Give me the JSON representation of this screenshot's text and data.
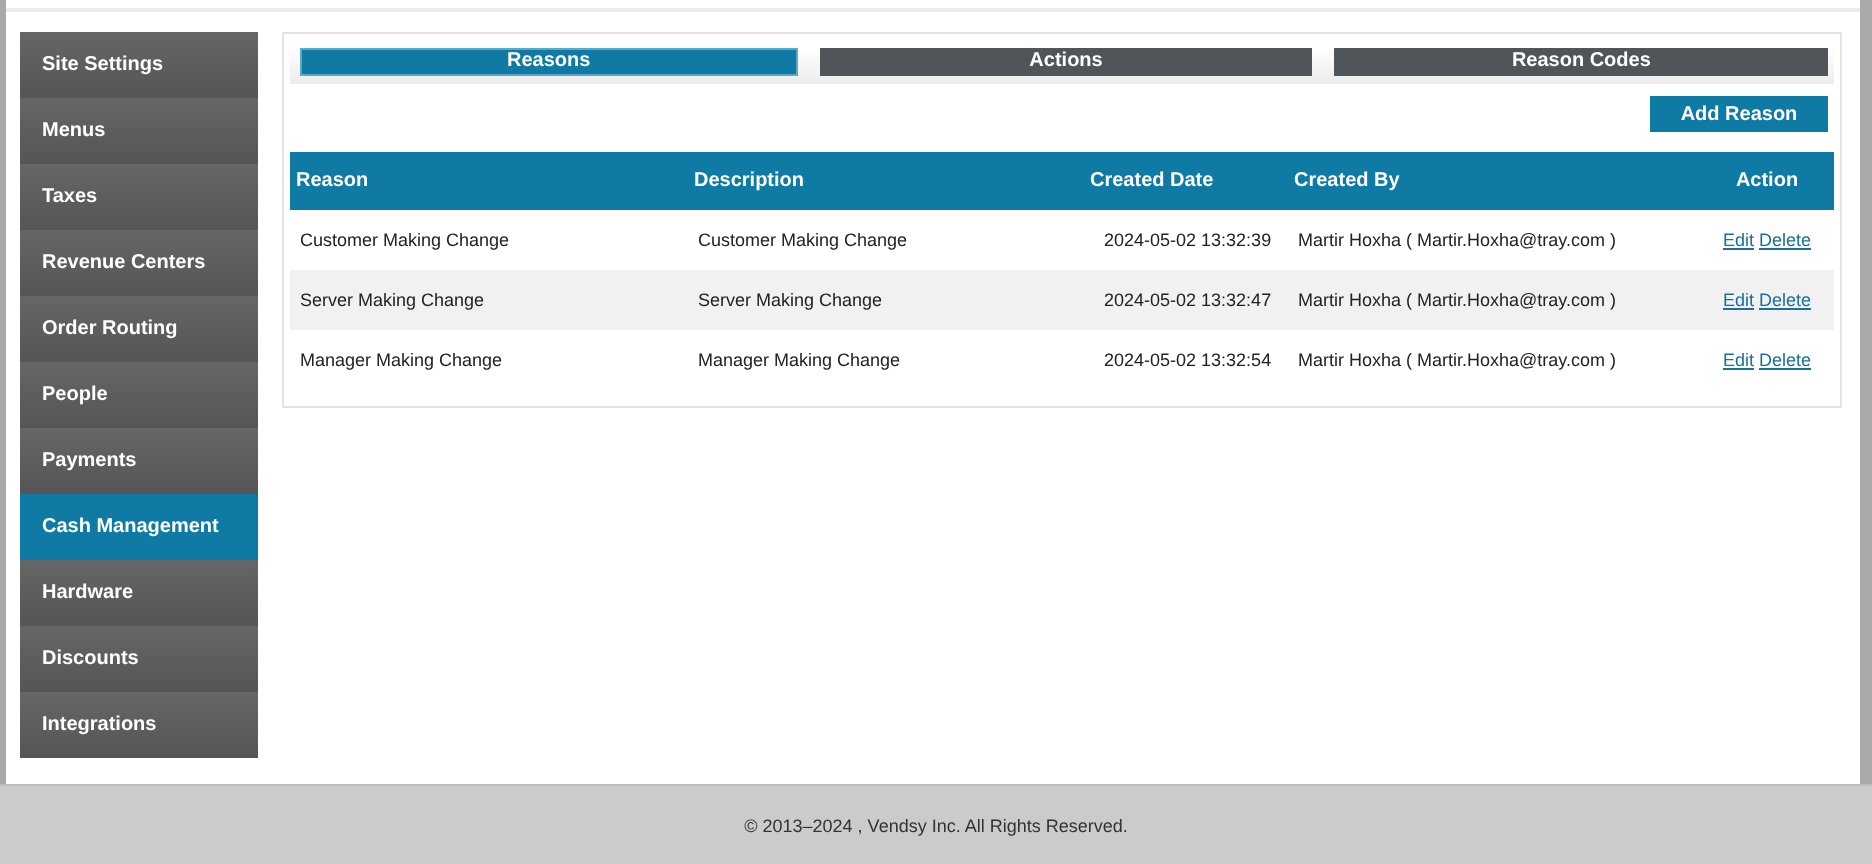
{
  "sidebar": {
    "items": [
      {
        "label": "Site Settings",
        "selected": false
      },
      {
        "label": "Menus",
        "selected": false
      },
      {
        "label": "Taxes",
        "selected": false
      },
      {
        "label": "Revenue Centers",
        "selected": false
      },
      {
        "label": "Order Routing",
        "selected": false
      },
      {
        "label": "People",
        "selected": false
      },
      {
        "label": "Payments",
        "selected": false
      },
      {
        "label": "Cash Management",
        "selected": true
      },
      {
        "label": "Hardware",
        "selected": false
      },
      {
        "label": "Discounts",
        "selected": false
      },
      {
        "label": "Integrations",
        "selected": false
      }
    ]
  },
  "tabs": [
    {
      "label": "Reasons",
      "selected": true
    },
    {
      "label": "Actions",
      "selected": false
    },
    {
      "label": "Reason Codes",
      "selected": false
    }
  ],
  "add_button": "Add Reason",
  "table": {
    "columns": [
      "Reason",
      "Description",
      "Created Date",
      "Created By",
      "Action"
    ],
    "rows": [
      {
        "reason": "Customer Making Change",
        "description": "Customer Making Change",
        "created_date": "2024-05-02 13:32:39",
        "created_by": "Martir Hoxha ( Martir.Hoxha@tray.com )",
        "actions": [
          "Edit",
          "Delete"
        ]
      },
      {
        "reason": "Server Making Change",
        "description": "Server Making Change",
        "created_date": "2024-05-02 13:32:47",
        "created_by": "Martir Hoxha ( Martir.Hoxha@tray.com )",
        "actions": [
          "Edit",
          "Delete"
        ]
      },
      {
        "reason": "Manager Making Change",
        "description": "Manager Making Change",
        "created_date": "2024-05-02 13:32:54",
        "created_by": "Martir Hoxha ( Martir.Hoxha@tray.com )",
        "actions": [
          "Edit",
          "Delete"
        ]
      }
    ]
  },
  "footer": "© 2013–2024 , Vendsy Inc. All Rights Reserved."
}
